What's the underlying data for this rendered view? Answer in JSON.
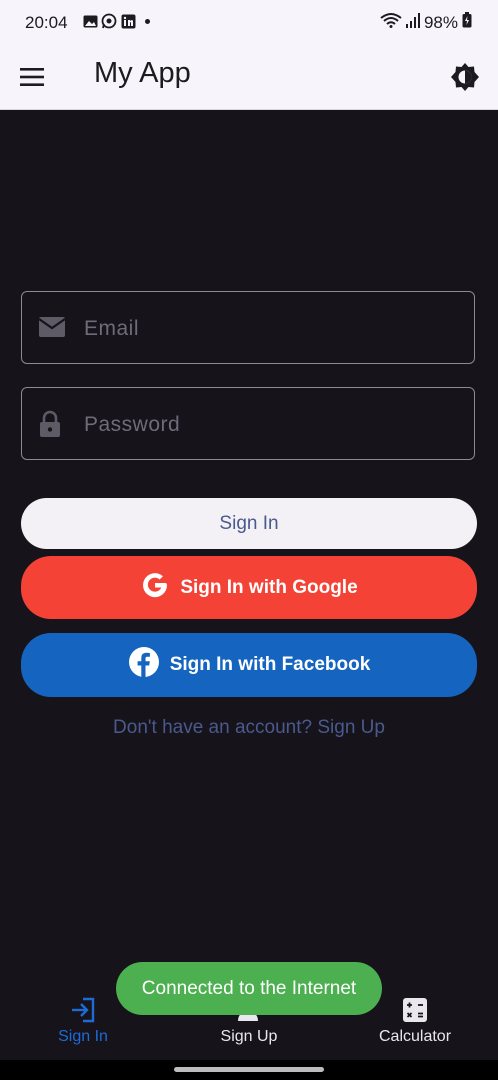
{
  "status_bar": {
    "time": "20:04",
    "notification_icons": [
      "image-icon",
      "whatsapp-icon",
      "linkedin-icon"
    ],
    "battery": "98%"
  },
  "app_bar": {
    "title": "My App",
    "menu_icon": "hamburger-menu-icon",
    "theme_icon": "brightness-icon"
  },
  "form": {
    "email_placeholder": "Email",
    "password_placeholder": "Password"
  },
  "buttons": {
    "sign_in": "Sign In",
    "google": "Sign In with Google",
    "facebook": "Sign In with Facebook"
  },
  "signup_link": "Don't have an account? Sign Up",
  "bottom_nav": {
    "items": [
      {
        "label": "Sign In",
        "icon": "login-icon",
        "active": true
      },
      {
        "label": "Sign Up",
        "icon": "person-add-icon",
        "active": false
      },
      {
        "label": "Calculator",
        "icon": "calculator-icon",
        "active": false
      }
    ]
  },
  "toast": "Connected to the Internet",
  "colors": {
    "background": "#16131b",
    "google": "#f44336",
    "facebook": "#1565c0",
    "toast": "#4caf50",
    "active_nav": "#1e6ad6"
  }
}
